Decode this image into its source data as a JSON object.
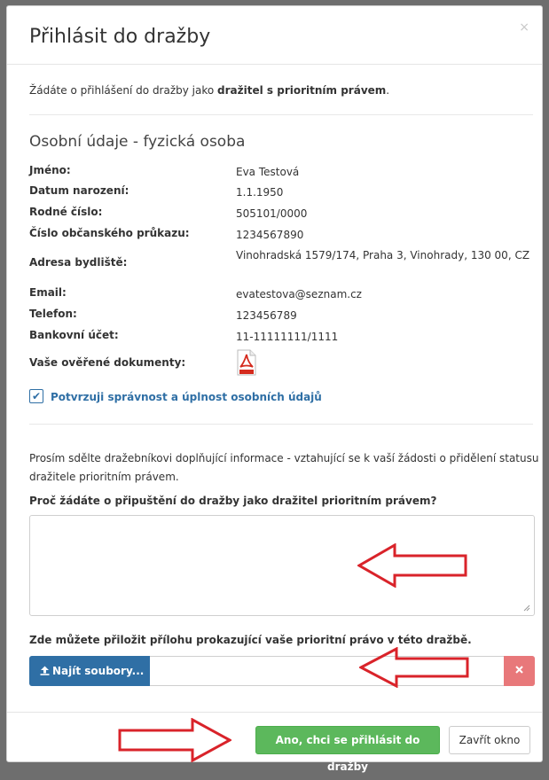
{
  "dialog": {
    "title": "Přihlásit do dražby",
    "close_glyph": "×"
  },
  "intro": {
    "text": "Žádáte o přihlášení do dražby jako ",
    "bold": "dražitel s prioritním právem",
    "suffix": "."
  },
  "personal": {
    "section_title": "Osobní údaje - fyzická osoba",
    "rows": [
      {
        "label": "Jméno:",
        "value": "Eva Testová"
      },
      {
        "label": "Datum narození:",
        "value": "1.1.1950"
      },
      {
        "label": "Rodné číslo:",
        "value": "505101/0000"
      },
      {
        "label": "Číslo občanského průkazu:",
        "value": "1234567890"
      },
      {
        "label": "Adresa bydliště:",
        "value": "Vinohradská 1579/174, Praha 3, Vinohrady, 130 00, CZ"
      },
      {
        "label": "Email:",
        "value": "evatestova@seznam.cz"
      },
      {
        "label": "Telefon:",
        "value": "123456789"
      },
      {
        "label": "Bankovní účet:",
        "value": "11-11111111/1111"
      },
      {
        "label": "Vaše ověřené dokumenty:",
        "value": ""
      }
    ],
    "document_icon": "pdf-icon",
    "confirm_label": "Potvrzuji správnost a úplnost osobních údajů",
    "confirm_checked": true
  },
  "additional": {
    "paragraph": "Prosím sdělte dražebníkovi doplňující informace - vztahující se k vaší žádosti o přidělení statusu dražitele prioritním právem.",
    "question_label": "Proč žádáte o připuštění do dražby jako dražitel prioritním právem?",
    "answer_value": "",
    "attachment_label": "Zde můžete přiložit přílohu prokazující vaše prioritní právo v této dražbě.",
    "browse_label": "Najít soubory...",
    "browse_icon": "upload-icon",
    "remove_icon": "remove-icon"
  },
  "footer": {
    "submit_label": "Ano, chci se přihlásit do dražby",
    "close_label": "Zavřít okno"
  },
  "colors": {
    "primary": "#2f6fa5",
    "success": "#5cb85c",
    "danger": "#e8787a",
    "annotation_arrow": "#d9232a",
    "overlay": "#6e6e6e"
  }
}
